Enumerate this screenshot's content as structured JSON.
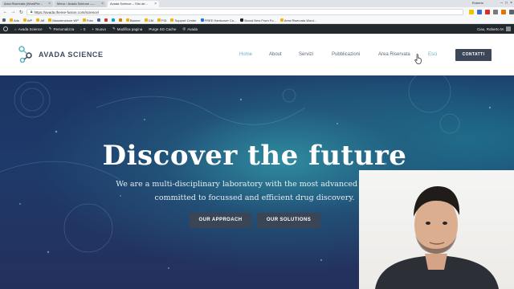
{
  "browser": {
    "tabs": [
      {
        "label": "Area Riservata (WordPre..."
      },
      {
        "label": "Menu ‹ Avada Science —..."
      },
      {
        "label": "Avada Science – Sito de..."
      }
    ],
    "user": "Roberto",
    "address": "https://avada.theme-fusion.com/science/",
    "bookmarks": [
      "Ads",
      "WP",
      "Aff",
      "Manutenzione WP",
      "Foto",
      "Banner",
      "CM",
      "FID",
      "Support Center",
      "FREE Hardcover Co...",
      "Brand New From Fo...",
      "Area Riservata Word..."
    ]
  },
  "wp_admin_bar": {
    "items": [
      "Avada Science",
      "Personalizza",
      "0",
      "Nuovo",
      "Modifica pagina",
      "Purge SG Cache",
      "Avada"
    ],
    "greeting": "Ciao, Roberto M."
  },
  "site": {
    "logo_text": "AVADA SCIENCE",
    "nav": [
      "Home",
      "About",
      "Servizi",
      "Pubblicazioni",
      "Area Riservata",
      "Esci"
    ],
    "cta": "CONTATTI"
  },
  "hero": {
    "title": "Discover the future",
    "subtitle_line1": "We are a multi-disciplinary laboratory with the most advanced equipme",
    "subtitle_line2": "committed to focussed and efficient drug discovery.",
    "button_approach": "OUR APPROACH",
    "button_solutions": "OUR SOLUTIONS"
  },
  "colors": {
    "accent": "#63b5c3",
    "dark": "#3c4858",
    "wp_bar": "#23282d"
  }
}
